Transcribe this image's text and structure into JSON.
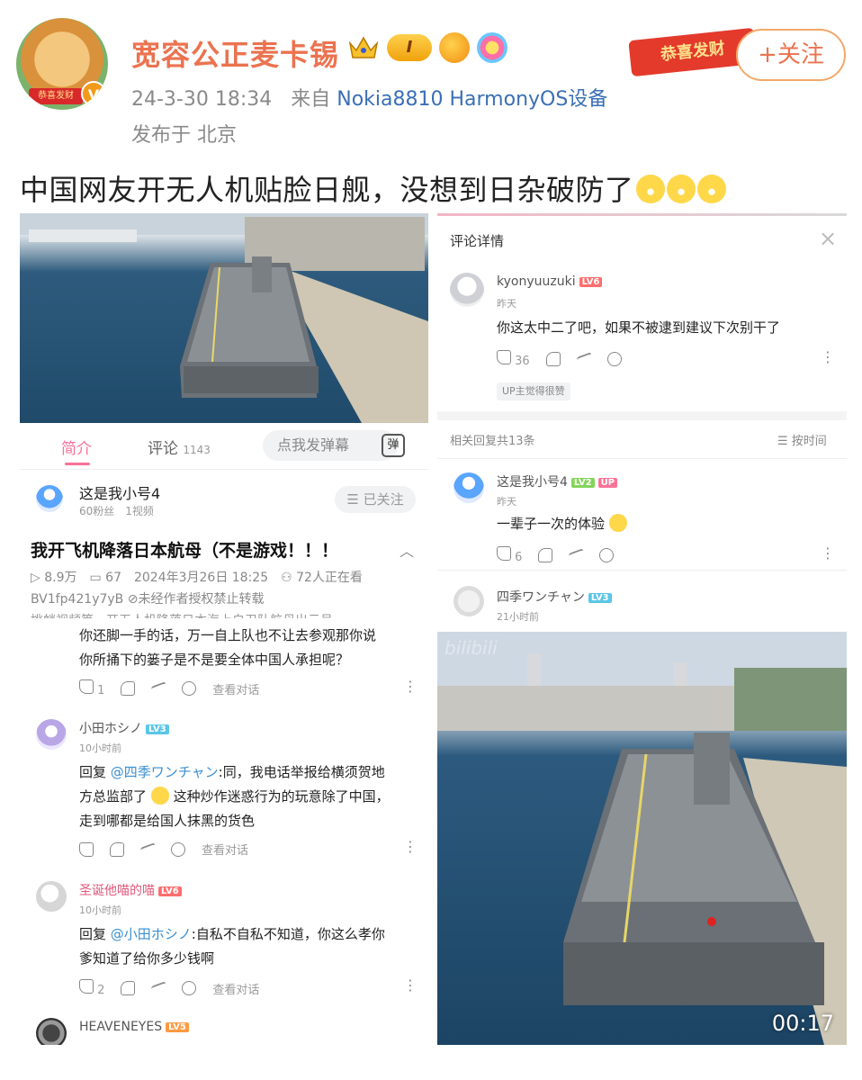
{
  "post": {
    "username": "宽容公正麦卡锡",
    "level_badge": "I",
    "timestamp": "24-3-30 18:34",
    "from_label": "来自",
    "source": "Nokia8810 HarmonyOS设备",
    "location": "发布于 北京",
    "follow_label": "+关注",
    "follow_deco_text": "恭喜发财",
    "avatar_ribbon": "恭喜发财",
    "verified_mark": "V",
    "text": "中国网友开无人机贴脸日舰，没想到日杂破防了"
  },
  "left": {
    "tabs": {
      "intro": "简介",
      "comments": "评论",
      "comments_count": "1143",
      "danmaku_placeholder": "点我发弹幕",
      "danmaku_icon": "弹"
    },
    "uploader": {
      "name": "这是我小号4",
      "stats": "60粉丝　1视频",
      "followed_label": "☰ 已关注"
    },
    "video": {
      "title": "我开飞机降落日本航母（不是游戏！！！",
      "stats": "▷ 8.9万　▭ 67　2024年3月26日 18:25　⚇ 72人正在看",
      "bv": "BV1fp421y7yB",
      "no_repost": "⊘未经作者授权禁止转载",
      "cut_text": "挑衅视频等，开无人机降落日本海上自卫队航母出云号"
    },
    "comments": [
      {
        "text": "你还脚一手的话，万一自上队也不让去参观那你说\n你所捅下的篓子是不是要全体中国人承担呢？",
        "likes": "1",
        "view_thread": "查看对话"
      },
      {
        "name": "小田ホシノ",
        "level": "LV3",
        "time": "10小时前",
        "reply_prefix": "回复 ",
        "mention": "@四季ワンチャン",
        "text_a": ":同，我电话举报给横须贺地\n方总监部了",
        "text_b": "这种炒作迷惑行为的玩意除了中国，\n走到哪都是给国人抹黑的货色",
        "view_thread": "查看对话"
      },
      {
        "name": "圣诞他喵的喵",
        "level": "LV6",
        "time": "10小时前",
        "reply_prefix": "回复 ",
        "mention": "@小田ホシノ",
        "text": ":自私不自私不知道，你这么孝你\n爹知道了给你多少钱啊",
        "likes": "2",
        "view_thread": "查看对话"
      },
      {
        "name": "HEAVENEYES",
        "level": "LV5"
      }
    ]
  },
  "right": {
    "panel_title": "评论详情",
    "close_glyph": "×",
    "main_comment": {
      "name": "kyonyuuzuki",
      "level": "LV6",
      "time": "昨天",
      "text": "你这太中二了吧，如果不被逮到建议下次别干了",
      "likes": "36",
      "tag": "UP主觉得很赞"
    },
    "replies_count": "相关回复共13条",
    "sort_label": "☰ 按时间",
    "reply1": {
      "name": "这是我小号4",
      "level": "LV2",
      "up_tag": "UP",
      "time": "昨天",
      "text": "一辈子一次的体验",
      "likes": "6"
    },
    "reply2": {
      "name": "四季ワンチャン",
      "level": "LV3",
      "time": "21小时前"
    },
    "video_time": "00:17",
    "watermark": "bilibili"
  },
  "colors": {
    "accent": "#eb7350",
    "bilibili_pink": "#fb7299",
    "link": "#3a6fb5"
  }
}
